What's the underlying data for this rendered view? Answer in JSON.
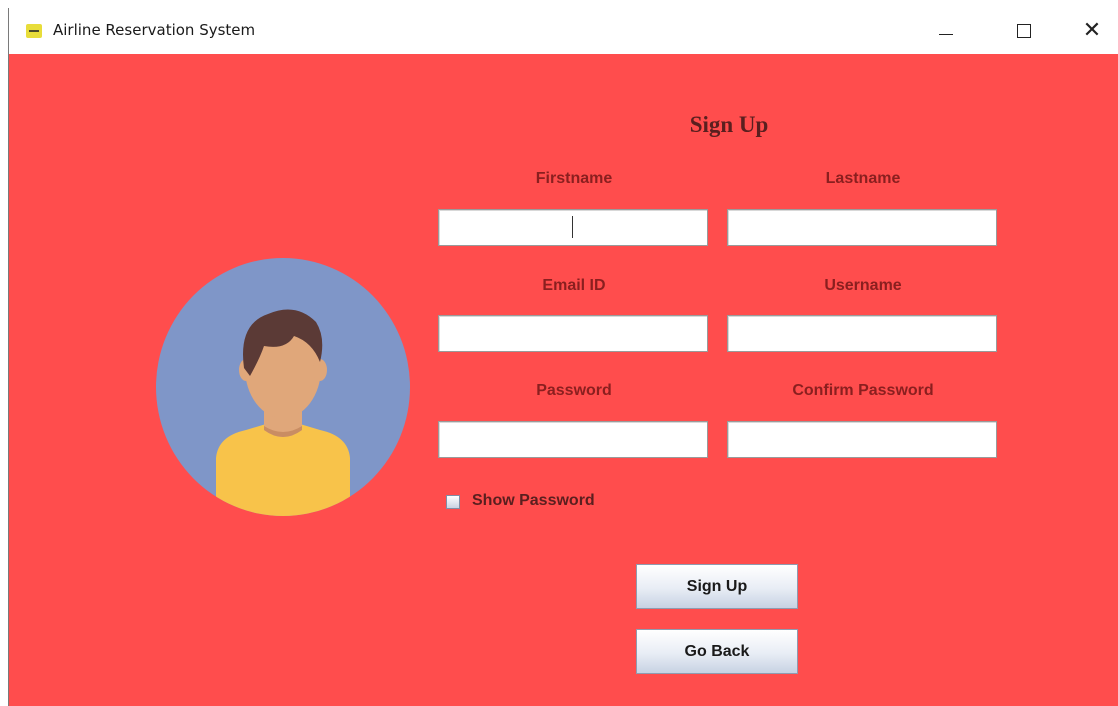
{
  "window": {
    "title": "Airline Reservation System",
    "controls": {
      "minimize": "—",
      "maximize": "☐",
      "close": "✕"
    }
  },
  "form": {
    "heading": "Sign Up",
    "fields": {
      "firstname": {
        "label": "Firstname",
        "value": ""
      },
      "lastname": {
        "label": "Lastname",
        "value": ""
      },
      "email": {
        "label": "Email ID",
        "value": ""
      },
      "username": {
        "label": "Username",
        "value": ""
      },
      "password": {
        "label": "Password",
        "value": ""
      },
      "confirm_password": {
        "label": "Confirm Password",
        "value": ""
      }
    },
    "show_password": {
      "label": "Show Password",
      "checked": false
    },
    "signup_button": "Sign Up",
    "goback_button": "Go Back"
  },
  "colors": {
    "background": "#ff4d4d",
    "avatar_circle": "#7f96c8",
    "shirt": "#f8c34a",
    "skin": "#e0a77a",
    "hair": "#5b3a36",
    "label_text": "#8a1f1f"
  }
}
